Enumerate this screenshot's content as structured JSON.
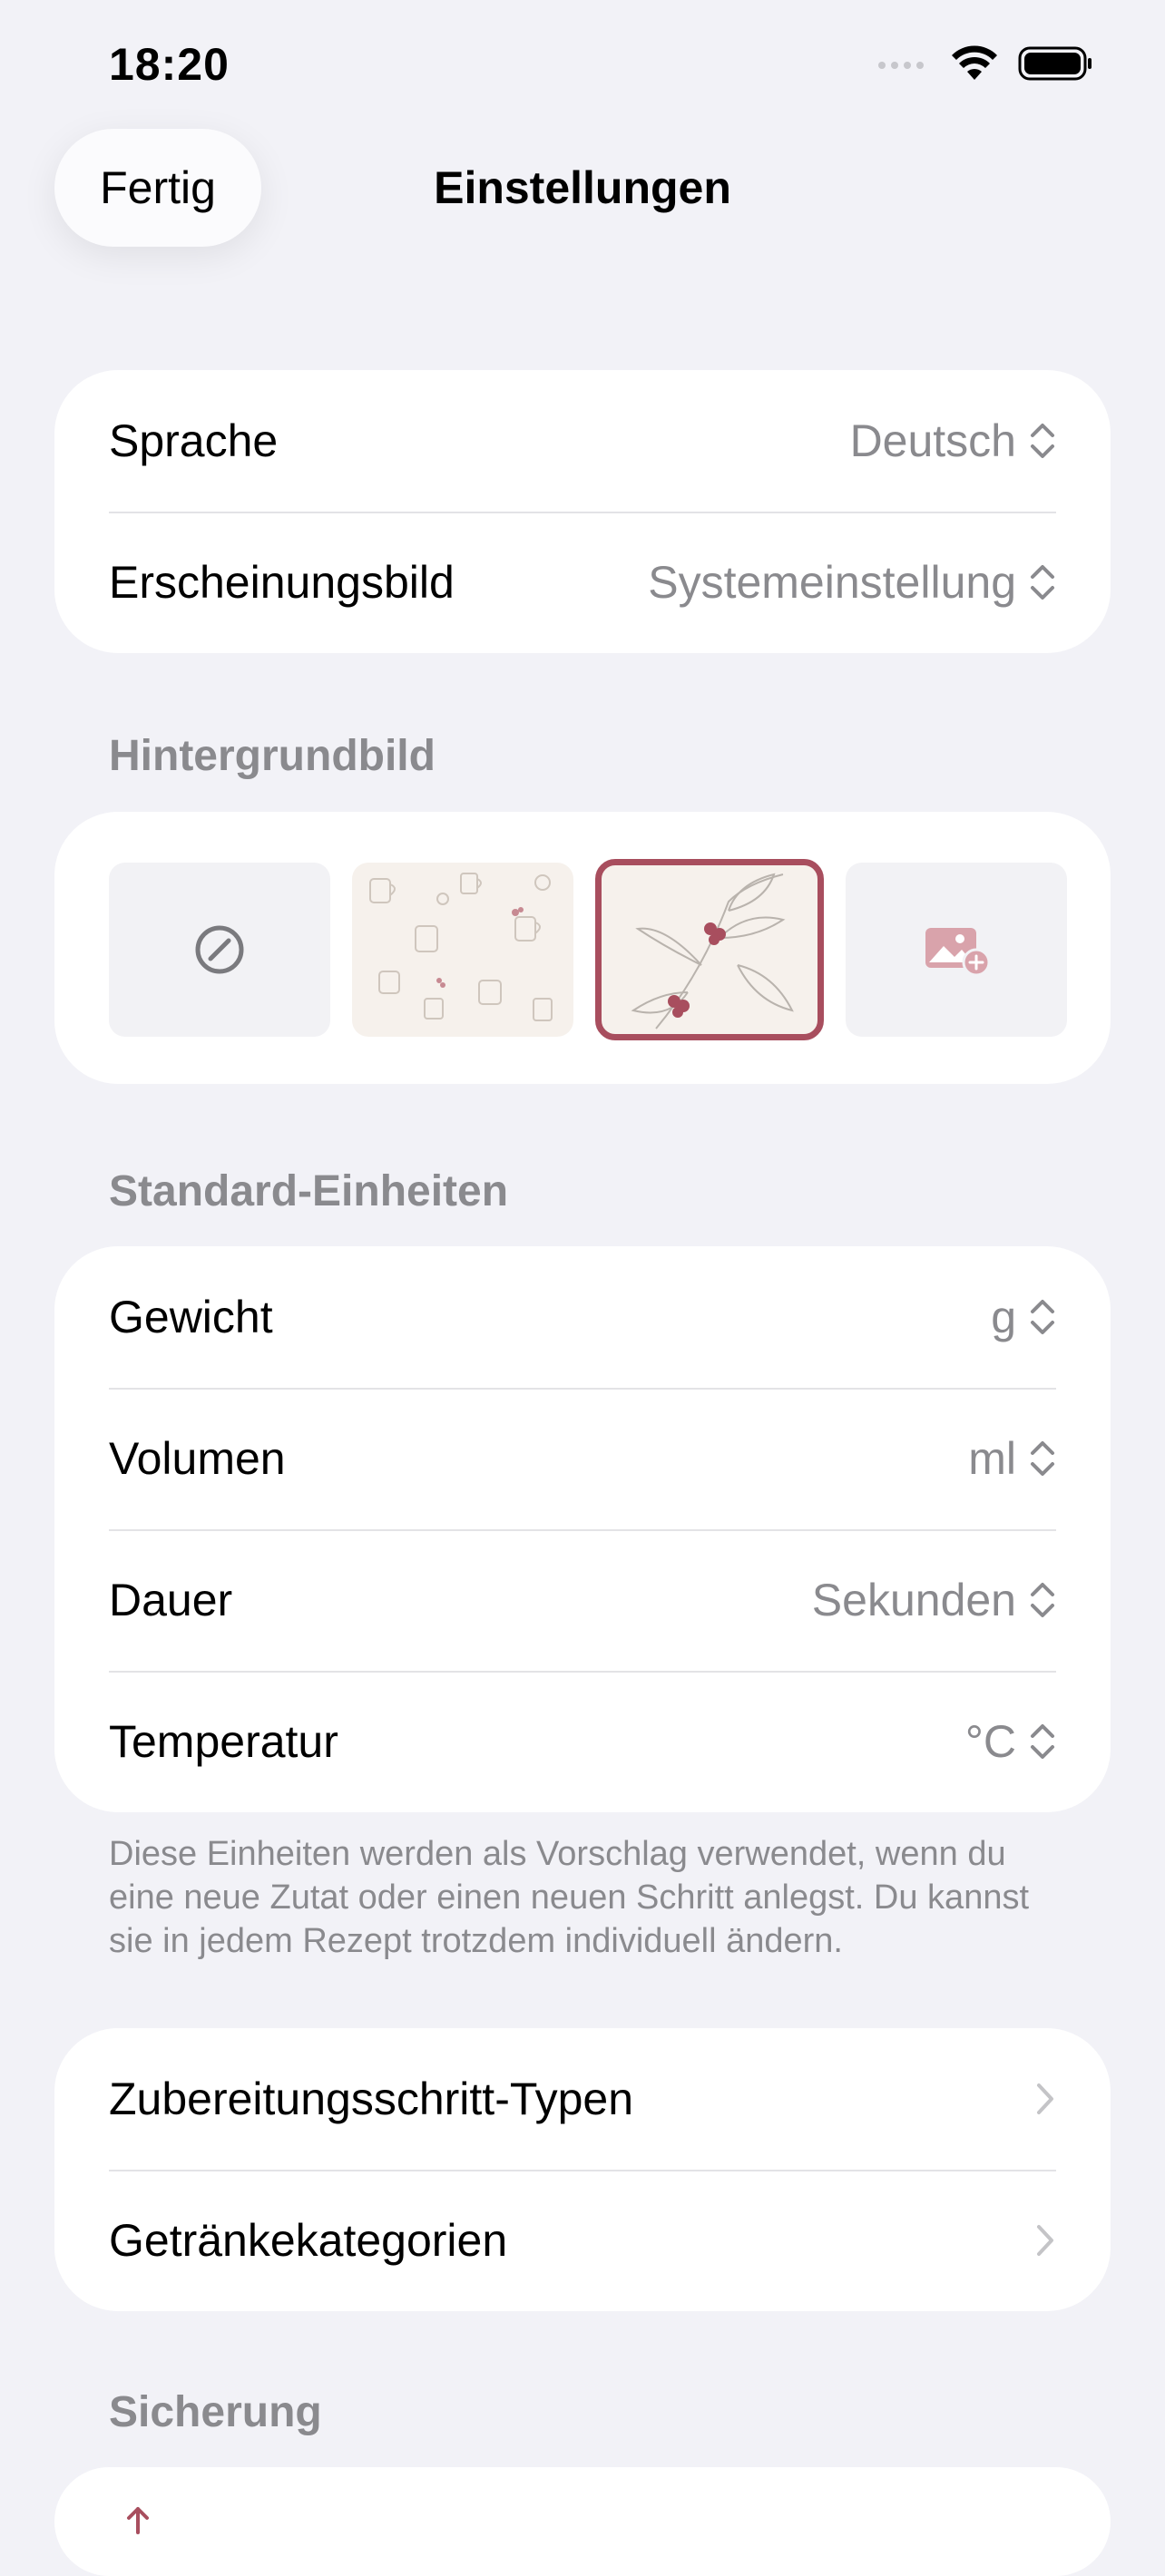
{
  "status_bar": {
    "time": "18:20"
  },
  "nav": {
    "done_label": "Fertig",
    "title": "Einstellungen"
  },
  "general": {
    "rows": [
      {
        "label": "Sprache",
        "value": "Deutsch"
      },
      {
        "label": "Erscheinungsbild",
        "value": "Systemeinstellung"
      }
    ]
  },
  "wallpaper": {
    "header": "Hintergrundbild",
    "options": [
      {
        "icon": "none-icon"
      },
      {
        "icon": "coffee-pattern-thumbnail"
      },
      {
        "icon": "coffee-branch-thumbnail",
        "selected": true
      },
      {
        "icon": "add-photo-icon"
      }
    ]
  },
  "units": {
    "header": "Standard-Einheiten",
    "rows": [
      {
        "label": "Gewicht",
        "value": "g"
      },
      {
        "label": "Volumen",
        "value": "ml"
      },
      {
        "label": "Dauer",
        "value": "Sekunden"
      },
      {
        "label": "Temperatur",
        "value": "°C"
      }
    ],
    "footnote": "Diese Einheiten werden als Vorschlag verwendet, wenn du eine neue Zutat oder einen neuen Schritt anlegst. Du kannst sie in jedem Rezept trotzdem individuell ändern."
  },
  "manage": {
    "rows": [
      {
        "label": "Zubereitungsschritt-Typen"
      },
      {
        "label": "Getränkekategorien"
      }
    ]
  },
  "backup": {
    "header": "Sicherung"
  },
  "colors": {
    "accent": "#a84e5e",
    "secondary_text": "#8a8a8e",
    "background": "#f2f2f7"
  }
}
